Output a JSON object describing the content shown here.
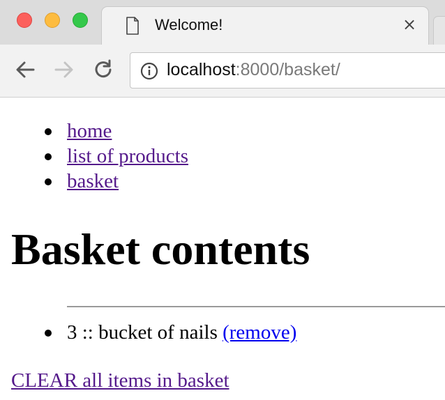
{
  "browser": {
    "tab_title": "Welcome!",
    "tab_close_glyph": "×",
    "url_host": "localhost",
    "url_rest": ":8000/basket/"
  },
  "nav": {
    "links": [
      {
        "label": "home"
      },
      {
        "label": "list of products"
      },
      {
        "label": "basket"
      }
    ]
  },
  "page": {
    "title": "Basket contents",
    "items": [
      {
        "quantity": "3",
        "separator": "::",
        "name": "bucket of nails",
        "action_label": "(remove)"
      }
    ],
    "clear_label": "CLEAR all items in basket"
  },
  "colors": {
    "visited_link": "#551a8b",
    "unvisited_link": "#0000ee",
    "close_red": "#fc605c",
    "minimize_yellow": "#fdbc40",
    "maximize_green": "#34c84a"
  }
}
